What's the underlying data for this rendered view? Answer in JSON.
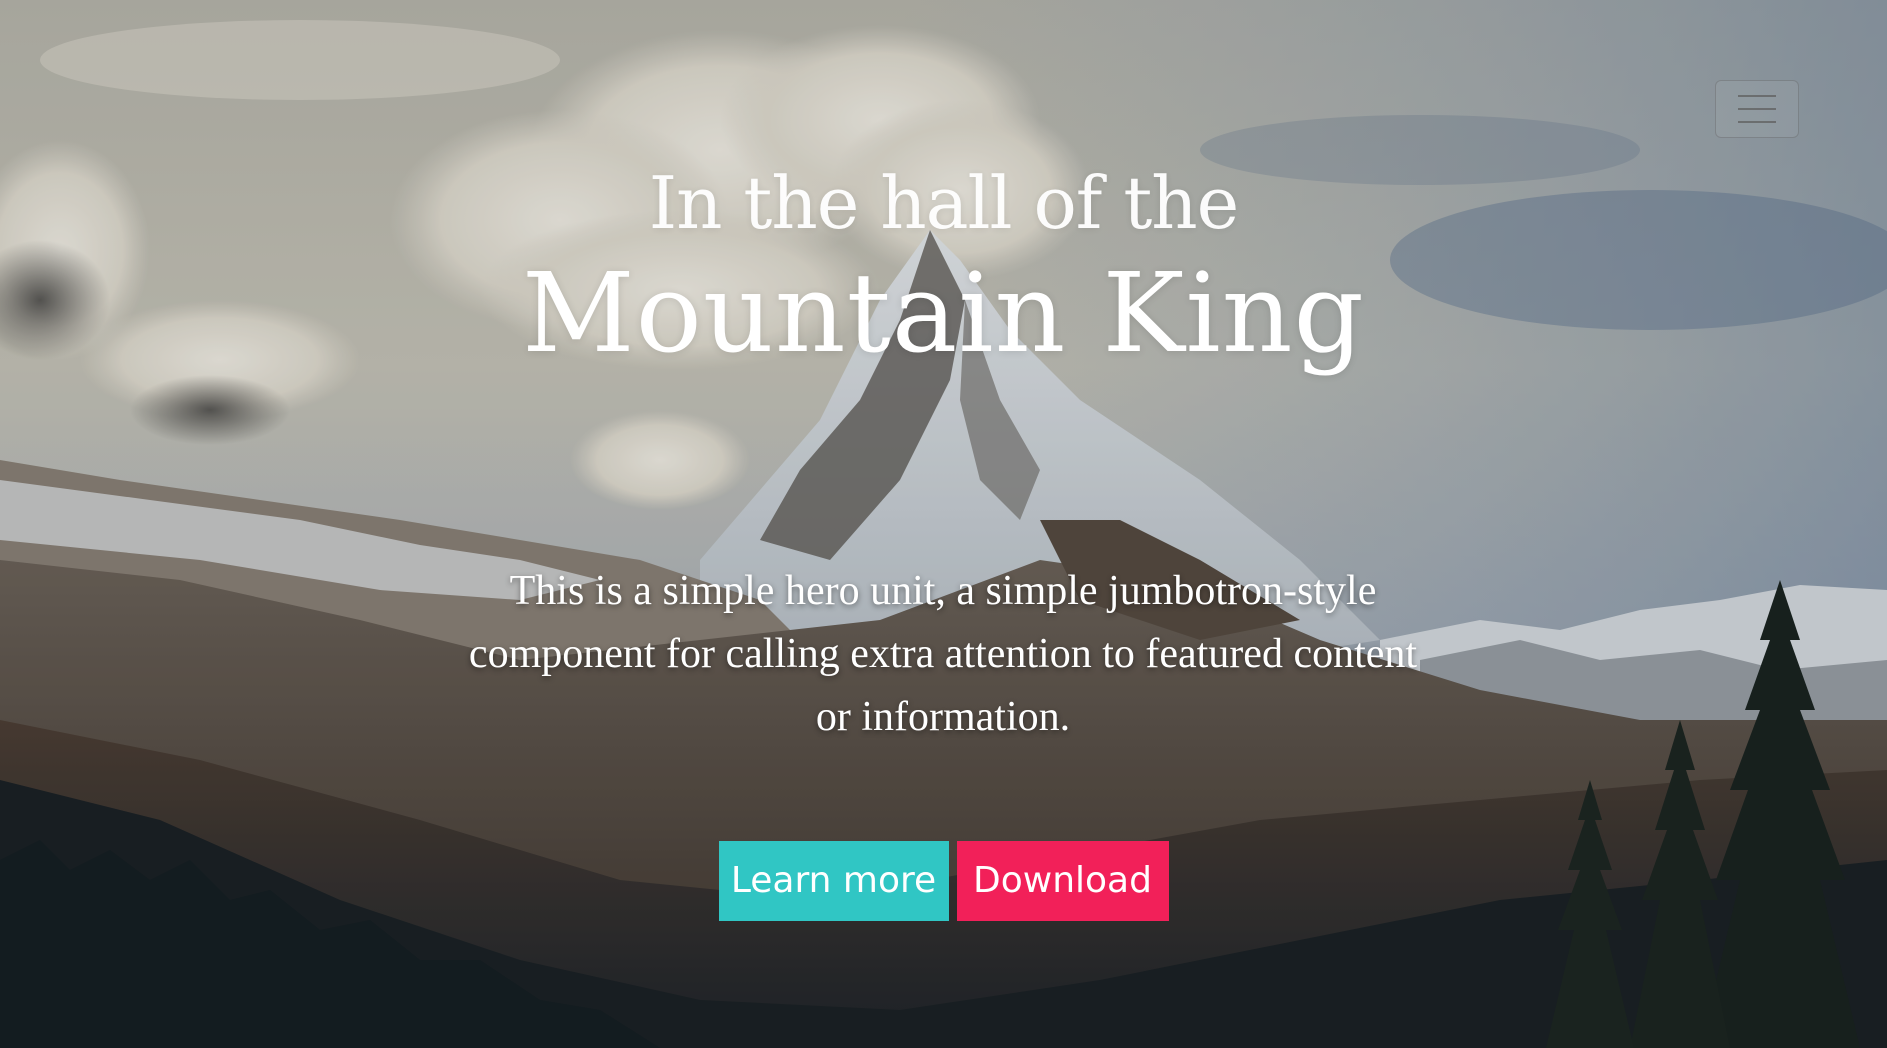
{
  "nav": {
    "menu_toggle_icon": "hamburger-icon"
  },
  "hero": {
    "title_line1": "In the hall of the",
    "title_line2": "Mountain King",
    "lead": "This is a simple hero unit, a simple jumbotron-style component for calling extra attention to featured content or information.",
    "background_image": "mountain-landscape-photo",
    "buttons": {
      "learn_more": "Learn more",
      "download": "Download"
    }
  },
  "colors": {
    "learn_more_button": "#30c6c4",
    "download_button": "#f22059",
    "text": "#ffffff"
  }
}
